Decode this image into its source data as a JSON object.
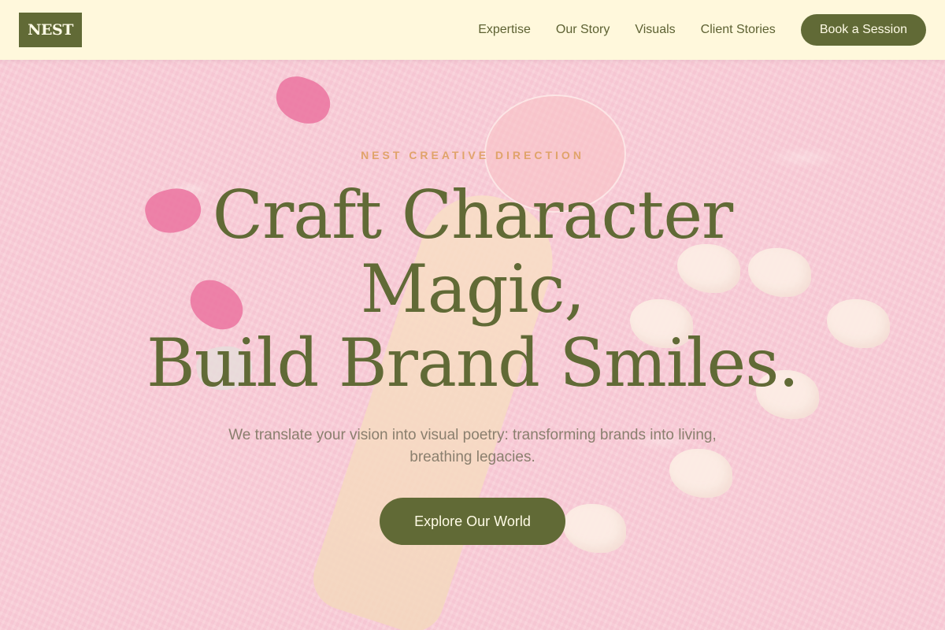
{
  "header": {
    "logo": "NEST",
    "nav": [
      "Expertise",
      "Our Story",
      "Visuals",
      "Client Stories"
    ],
    "cta_label": "Book a Session"
  },
  "hero": {
    "eyebrow": "NEST CREATIVE DIRECTION",
    "headline_lines": [
      "Craft Character",
      "Magic,",
      "Build Brand Smiles."
    ],
    "subtitle": "We translate your vision into visual poetry: transforming brands into living, breathing legacies.",
    "button_label": "Explore Our World"
  },
  "colors": {
    "brand_olive": "#616a36",
    "header_bg": "#fff8dc",
    "eyebrow_accent": "#e0a36a",
    "hero_pink": "#f4b8cf"
  }
}
